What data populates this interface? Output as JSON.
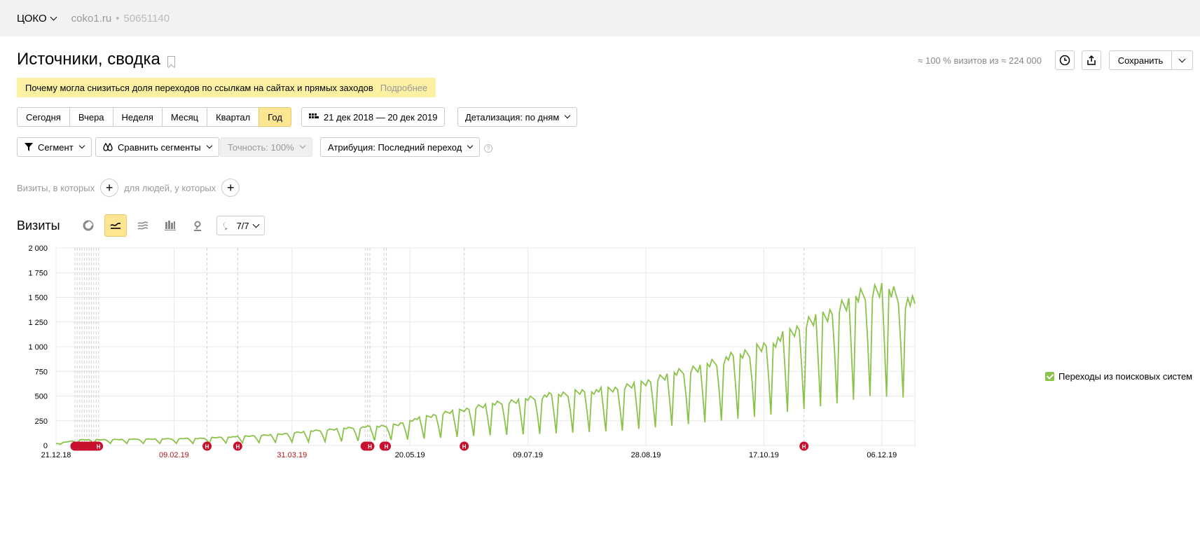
{
  "topbar": {
    "counter": "ЦОКО",
    "site": "coko1.ru",
    "separator": "•",
    "counter_id": "50651140"
  },
  "header": {
    "title": "Источники, сводка",
    "visits_share": "≈ 100 % визитов из ≈ 224 000",
    "save_label": "Сохранить"
  },
  "notice": {
    "text": "Почему могла снизиться доля переходов по ссылкам на сайтах и прямых заходов",
    "link": "Подробнее"
  },
  "periods": [
    "Сегодня",
    "Вчера",
    "Неделя",
    "Месяц",
    "Квартал",
    "Год"
  ],
  "active_period": "Год",
  "date_range": "21 дек 2018 — 20 дек 2019",
  "detail": "Детализация: по дням",
  "segment_label": "Сегмент",
  "compare_label": "Сравнить сегменты",
  "accuracy_label": "Точность: 100%",
  "attribution_label": "Атрибуция: Последний переход",
  "help_glyph": "?",
  "filters": {
    "visits_where": "Визиты, в которых",
    "people_where": "для людей, у которых",
    "add_glyph": "+"
  },
  "chart_header": {
    "title": "Визиты",
    "notes_count": "7/7"
  },
  "icons": [
    "pie-chart-icon",
    "line-chart-icon",
    "area-chart-icon",
    "bar-chart-icon",
    "map-icon",
    "comment-icon"
  ],
  "colors": {
    "series": "#8bc34a",
    "active": "#fde591",
    "note_marker": "#c8102e",
    "holiday_label": "#b4161b"
  },
  "chart_data": {
    "type": "line",
    "ylim": [
      0,
      2000
    ],
    "y_ticks": [
      "0",
      "250",
      "500",
      "750",
      "1 000",
      "1 250",
      "1 500",
      "1 750",
      "2 000"
    ],
    "x_ticks": [
      {
        "label": "21.12.18",
        "day": 0,
        "holiday": false
      },
      {
        "label": "09.02.19",
        "day": 50,
        "holiday": true
      },
      {
        "label": "31.03.19",
        "day": 100,
        "holiday": true
      },
      {
        "label": "20.05.19",
        "day": 150,
        "holiday": false
      },
      {
        "label": "09.07.19",
        "day": 200,
        "holiday": false
      },
      {
        "label": "28.08.19",
        "day": 250,
        "holiday": false
      },
      {
        "label": "17.10.19",
        "day": 300,
        "holiday": false
      },
      {
        "label": "06.12.19",
        "day": 350,
        "holiday": false
      }
    ],
    "note_marker_label": "Н",
    "note_days": [
      8,
      9,
      10,
      11,
      12,
      13,
      14,
      15,
      16,
      17,
      18,
      64,
      77,
      131,
      132,
      133,
      139,
      140,
      173,
      317
    ],
    "series": [
      {
        "name": "Переходы из поисковых систем",
        "weekday_peaks": [
          [
            0,
            20
          ],
          [
            10,
            60
          ],
          [
            30,
            65
          ],
          [
            60,
            75
          ],
          [
            90,
            110
          ],
          [
            120,
            180
          ],
          [
            145,
            220
          ],
          [
            150,
            270
          ],
          [
            180,
            420
          ],
          [
            210,
            540
          ],
          [
            240,
            610
          ],
          [
            270,
            820
          ],
          [
            300,
            1050
          ],
          [
            330,
            1450
          ],
          [
            350,
            1700
          ],
          [
            364,
            1500
          ]
        ],
        "weekend_troughs": [
          [
            0,
            10
          ],
          [
            10,
            20
          ],
          [
            60,
            20
          ],
          [
            120,
            40
          ],
          [
            150,
            60
          ],
          [
            180,
            100
          ],
          [
            210,
            120
          ],
          [
            240,
            150
          ],
          [
            270,
            220
          ],
          [
            300,
            300
          ],
          [
            330,
            420
          ],
          [
            345,
            500
          ],
          [
            364,
            480
          ]
        ],
        "values_note": "daily visits, 21.12.18–20.12.19, weekly seasonality; peaks approximated from chart"
      }
    ]
  }
}
